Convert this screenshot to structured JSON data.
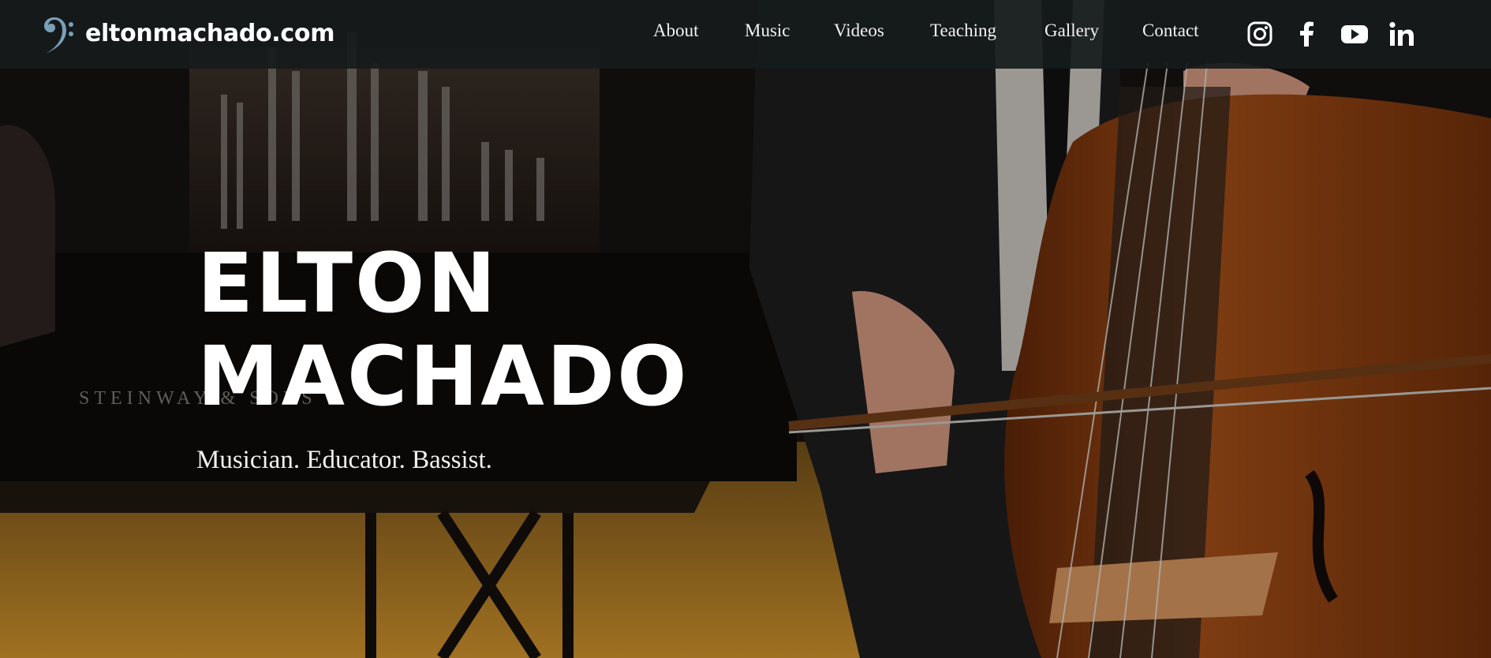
{
  "site": {
    "brand_name": "eltonmachado.com",
    "brand_icon": "bass-clef-icon"
  },
  "nav": {
    "items": [
      {
        "label": "About"
      },
      {
        "label": "Music"
      },
      {
        "label": "Videos"
      },
      {
        "label": "Teaching"
      },
      {
        "label": "Gallery"
      },
      {
        "label": "Contact"
      }
    ]
  },
  "social": {
    "icons": [
      "instagram-icon",
      "facebook-icon",
      "youtube-icon",
      "linkedin-icon"
    ]
  },
  "hero": {
    "title_line1": "ELTON",
    "title_line2": "MACHADO",
    "tagline": "Musician. Educator. Bassist.",
    "background_text": "STEINWAY & SONS"
  },
  "colors": {
    "topbar": "#161b1c",
    "text": "#ffffff",
    "accent_wood": "#8a3f12",
    "stage_floor": "#c98f2c"
  }
}
